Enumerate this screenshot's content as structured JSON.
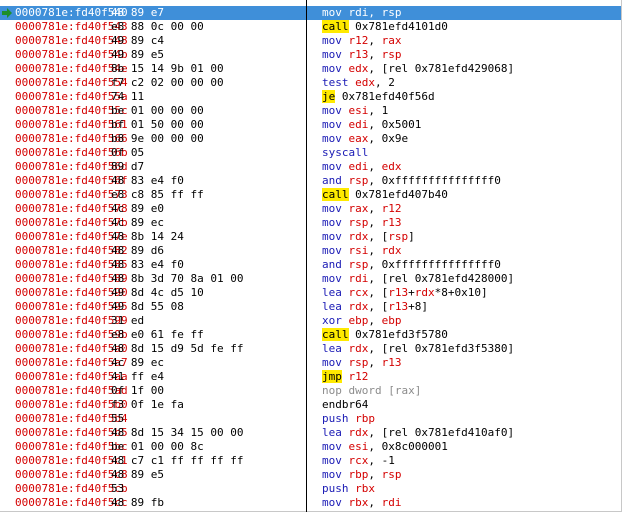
{
  "colors": {
    "address": "#d40000",
    "mnemonic": "#1a1ab5",
    "register": "#d40000",
    "selection": "#3f8fd9",
    "branch_highlight": "#ffea00",
    "nop": "#8c8c8c"
  },
  "rows": [
    {
      "addr": "0000781e:fd40f540",
      "bytes": "48 89 e7",
      "mn": "mov",
      "ops": "rdi, rsp",
      "selected": true
    },
    {
      "addr": "0000781e:fd40f543",
      "bytes": "e8 88 0c 00 00",
      "mn": "call",
      "ops": "0x781efd4101d0",
      "hl": true
    },
    {
      "addr": "0000781e:fd40f548",
      "bytes": "49 89 c4",
      "mn": "mov",
      "ops": "r12, rax"
    },
    {
      "addr": "0000781e:fd40f54b",
      "bytes": "49 89 e5",
      "mn": "mov",
      "ops": "r13, rsp"
    },
    {
      "addr": "0000781e:fd40f54e",
      "bytes": "8b 15 14 9b 01 00",
      "mn": "mov",
      "ops": "edx, [rel 0x781efd429068]"
    },
    {
      "addr": "0000781e:fd40f554",
      "bytes": "f7 c2 02 00 00 00",
      "mn": "test",
      "ops": "edx, 2"
    },
    {
      "addr": "0000781e:fd40f55a",
      "bytes": "74 11",
      "mn": "je",
      "ops": "0x781efd40f56d",
      "hl": true
    },
    {
      "addr": "0000781e:fd40f55c",
      "bytes": "be 01 00 00 00",
      "mn": "mov",
      "ops": "esi, 1"
    },
    {
      "addr": "0000781e:fd40f561",
      "bytes": "bf 01 50 00 00",
      "mn": "mov",
      "ops": "edi, 0x5001"
    },
    {
      "addr": "0000781e:fd40f566",
      "bytes": "b8 9e 00 00 00",
      "mn": "mov",
      "ops": "eax, 0x9e"
    },
    {
      "addr": "0000781e:fd40f56b",
      "bytes": "0f 05",
      "mn": "syscall",
      "ops": ""
    },
    {
      "addr": "0000781e:fd40f56d",
      "bytes": "89 d7",
      "mn": "mov",
      "ops": "edi, edx"
    },
    {
      "addr": "0000781e:fd40f56f",
      "bytes": "48 83 e4 f0",
      "mn": "and",
      "ops": "rsp, 0xfffffffffffffff0"
    },
    {
      "addr": "0000781e:fd40f573",
      "bytes": "e8 c8 85 ff ff",
      "mn": "call",
      "ops": "0x781efd407b40",
      "hl": true
    },
    {
      "addr": "0000781e:fd40f578",
      "bytes": "4c 89 e0",
      "mn": "mov",
      "ops": "rax, r12"
    },
    {
      "addr": "0000781e:fd40f57b",
      "bytes": "4c 89 ec",
      "mn": "mov",
      "ops": "rsp, r13"
    },
    {
      "addr": "0000781e:fd40f57e",
      "bytes": "48 8b 14 24",
      "mn": "mov",
      "ops": "rdx, [rsp]"
    },
    {
      "addr": "0000781e:fd40f582",
      "bytes": "48 89 d6",
      "mn": "mov",
      "ops": "rsi, rdx"
    },
    {
      "addr": "0000781e:fd40f585",
      "bytes": "48 83 e4 f0",
      "mn": "and",
      "ops": "rsp, 0xfffffffffffffff0"
    },
    {
      "addr": "0000781e:fd40f589",
      "bytes": "48 8b 3d 70 8a 01 00",
      "mn": "mov",
      "ops": "rdi, [rel 0x781efd428000]"
    },
    {
      "addr": "0000781e:fd40f590",
      "bytes": "49 8d 4c d5 10",
      "mn": "lea",
      "ops": "rcx, [r13+rdx*8+0x10]"
    },
    {
      "addr": "0000781e:fd40f595",
      "bytes": "49 8d 55 08",
      "mn": "lea",
      "ops": "rdx, [r13+8]"
    },
    {
      "addr": "0000781e:fd40f599",
      "bytes": "31 ed",
      "mn": "xor",
      "ops": "ebp, ebp"
    },
    {
      "addr": "0000781e:fd40f59b",
      "bytes": "e8 e0 61 fe ff",
      "mn": "call",
      "ops": "0x781efd3f5780",
      "hl": true
    },
    {
      "addr": "0000781e:fd40f5a0",
      "bytes": "48 8d 15 d9 5d fe ff",
      "mn": "lea",
      "ops": "rdx, [rel 0x781efd3f5380]"
    },
    {
      "addr": "0000781e:fd40f5a7",
      "bytes": "4c 89 ec",
      "mn": "mov",
      "ops": "rsp, r13"
    },
    {
      "addr": "0000781e:fd40f5aa",
      "bytes": "41 ff e4",
      "mn": "jmp",
      "ops": "r12",
      "hl": true
    },
    {
      "addr": "0000781e:fd40f5ad",
      "bytes": "0f 1f 00",
      "mn": "nop",
      "ops": "dword [rax]",
      "nop": true
    },
    {
      "addr": "0000781e:fd40f5b0",
      "bytes": "f3 0f 1e fa",
      "mn": "endbr64",
      "ops": "",
      "plain": true
    },
    {
      "addr": "0000781e:fd40f5b4",
      "bytes": "55",
      "mn": "push",
      "ops": "rbp"
    },
    {
      "addr": "0000781e:fd40f5b5",
      "bytes": "48 8d 15 34 15 00 00",
      "mn": "lea",
      "ops": "rdx, [rel 0x781efd410af0]"
    },
    {
      "addr": "0000781e:fd40f5bc",
      "bytes": "be 01 00 00 8c",
      "mn": "mov",
      "ops": "esi, 0x8c000001"
    },
    {
      "addr": "0000781e:fd40f5c1",
      "bytes": "48 c7 c1 ff ff ff ff",
      "mn": "mov",
      "ops": "rcx, -1"
    },
    {
      "addr": "0000781e:fd40f5c8",
      "bytes": "48 89 e5",
      "mn": "mov",
      "ops": "rbp, rsp"
    },
    {
      "addr": "0000781e:fd40f5cb",
      "bytes": "53",
      "mn": "push",
      "ops": "rbx"
    },
    {
      "addr": "0000781e:fd40f5cc",
      "bytes": "48 89 fb",
      "mn": "mov",
      "ops": "rbx, rdi"
    }
  ]
}
